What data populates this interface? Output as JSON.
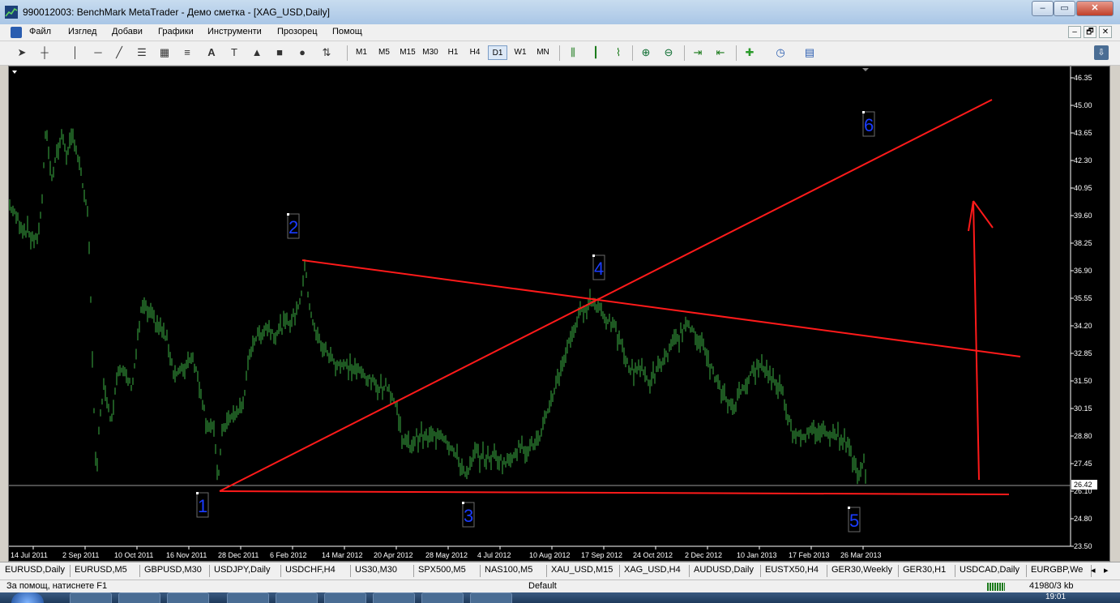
{
  "window": {
    "title": "990012003: BenchMark MetaTrader - Демо сметка - [XAG_USD,Daily]",
    "minimize": "‒",
    "maximize": "▭",
    "close": "✕"
  },
  "menu": {
    "items": [
      "Файл",
      "Изглед",
      "Добави",
      "Графики",
      "Инструменти",
      "Прозорец",
      "Помощ"
    ],
    "mdi": [
      "‒",
      "🗗",
      "✕"
    ]
  },
  "toolbar": {
    "timeframes": [
      "M1",
      "M5",
      "M15",
      "M30",
      "H1",
      "H4",
      "D1",
      "W1",
      "MN"
    ],
    "active_timeframe": "D1",
    "text_tool": "A"
  },
  "chart": {
    "symbol": "XAG_USD",
    "period": "Daily",
    "current_price": "26.42",
    "price_axis": [
      "46.35",
      "45.00",
      "43.65",
      "42.30",
      "40.95",
      "39.60",
      "38.25",
      "36.90",
      "35.55",
      "34.20",
      "32.85",
      "31.50",
      "30.15",
      "28.80",
      "27.45",
      "26.10",
      "24.80",
      "23.50"
    ],
    "time_axis": [
      "14 Jul 2011",
      "2 Sep 2011",
      "10 Oct 2011",
      "16 Nov 2011",
      "28 Dec 2011",
      "6 Feb 2012",
      "14 Mar 2012",
      "20 Apr 2012",
      "28 May 2012",
      "4 Jul 2012",
      "10 Aug 2012",
      "17 Sep 2012",
      "24 Oct 2012",
      "2 Dec 2012",
      "10 Jan 2013",
      "17 Feb 2013",
      "26 Mar 2013"
    ],
    "wave_labels": [
      "1",
      "2",
      "3",
      "4",
      "5",
      "6"
    ],
    "colors": {
      "background": "#000000",
      "bars": "#3cb043",
      "trendlines": "#ff1a1a",
      "labels": "#1a3cff",
      "axis_text": "#ffffff"
    }
  },
  "tabs": [
    "EURUSD,Daily",
    "EURUSD,M5",
    "GBPUSD,M30",
    "USDJPY,Daily",
    "USDCHF,H4",
    "US30,M30",
    "SPX500,M5",
    "NAS100,M5",
    "XAU_USD,M15",
    "XAG_USD,H4",
    "AUDUSD,Daily",
    "EUSTX50,H4",
    "GER30,Weekly",
    "GER30,H1",
    "USDCAD,Daily",
    "EURGBP,We"
  ],
  "tab_nav": [
    "◂",
    "▸"
  ],
  "status": {
    "help": "За помощ, натиснете F1",
    "profile": "Default",
    "traffic": "41980/3 kb"
  },
  "taskbar": {
    "clock": "19:01"
  }
}
